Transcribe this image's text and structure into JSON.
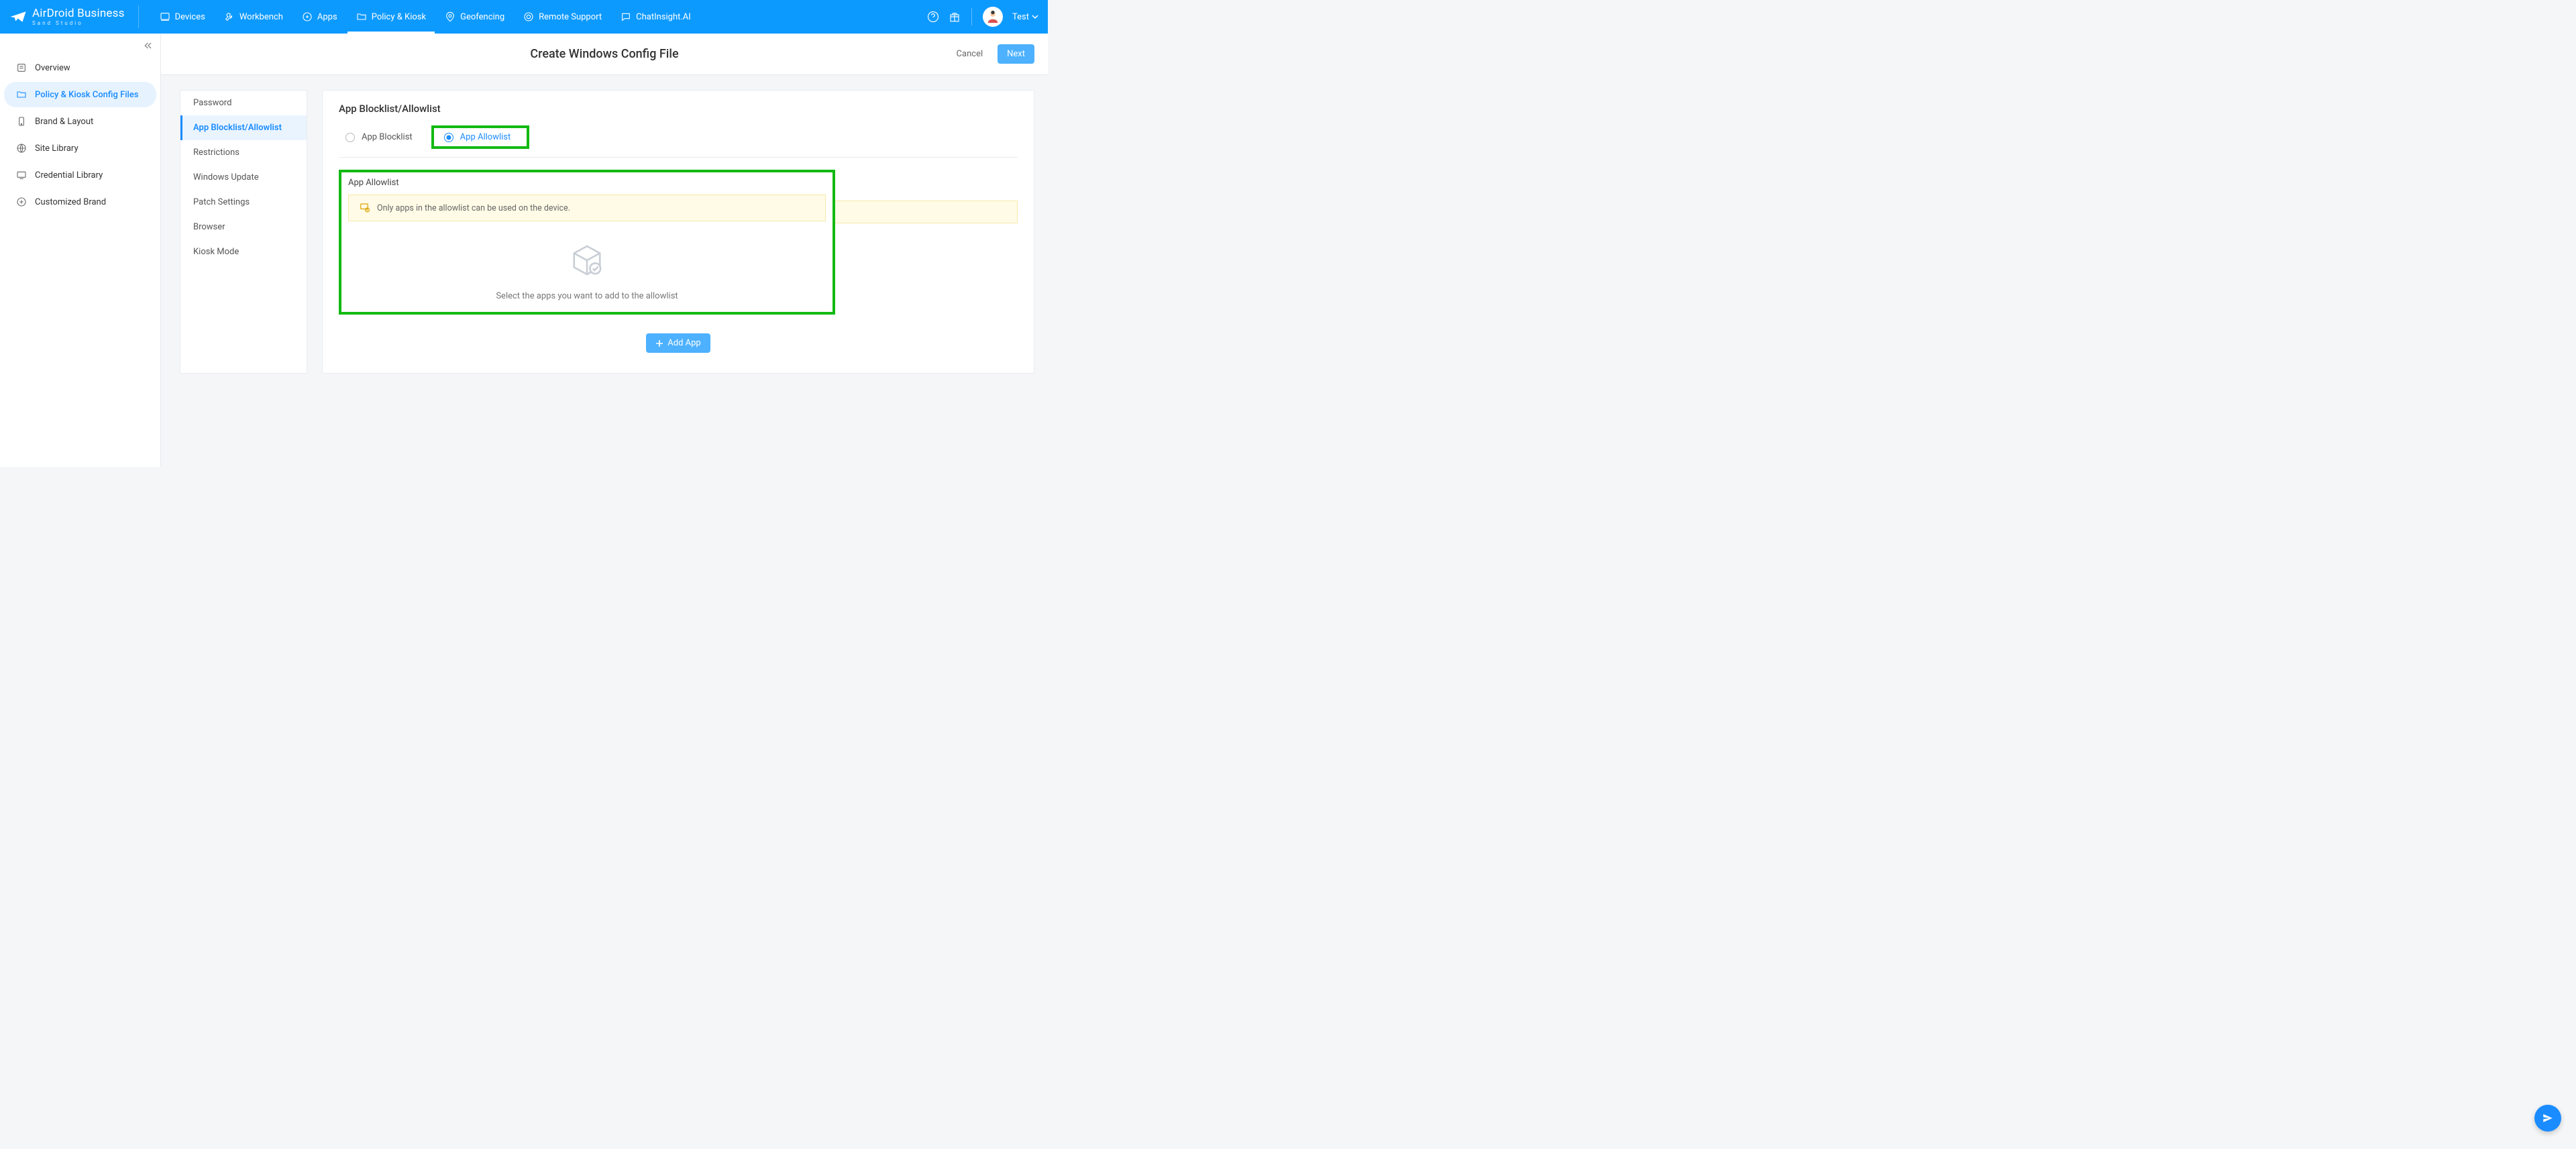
{
  "brand": {
    "name": "AirDroid Business",
    "sub": "Sand Studio"
  },
  "topnav": {
    "items": [
      {
        "label": "Devices"
      },
      {
        "label": "Workbench"
      },
      {
        "label": "Apps"
      },
      {
        "label": "Policy & Kiosk"
      },
      {
        "label": "Geofencing"
      },
      {
        "label": "Remote Support"
      },
      {
        "label": "ChatInsight.AI"
      }
    ],
    "user": "Test"
  },
  "sidebar": {
    "items": [
      {
        "label": "Overview"
      },
      {
        "label": "Policy & Kiosk Config Files"
      },
      {
        "label": "Brand & Layout"
      },
      {
        "label": "Site Library"
      },
      {
        "label": "Credential Library"
      },
      {
        "label": "Customized Brand"
      }
    ]
  },
  "page": {
    "title": "Create Windows Config File",
    "cancel": "Cancel",
    "next": "Next"
  },
  "sub_sidebar": {
    "items": [
      {
        "label": "Password"
      },
      {
        "label": "App Blocklist/Allowlist"
      },
      {
        "label": "Restrictions"
      },
      {
        "label": "Windows Update"
      },
      {
        "label": "Patch Settings"
      },
      {
        "label": "Browser"
      },
      {
        "label": "Kiosk Mode"
      }
    ]
  },
  "panel": {
    "title": "App Blocklist/Allowlist",
    "radio": {
      "blocklist": "App Blocklist",
      "allowlist": "App Allowlist"
    },
    "section_title": "App Allowlist",
    "info": "Only apps in the allowlist can be used on the device.",
    "empty": "Select the apps you want to add to the allowlist",
    "add_button": "Add App"
  }
}
